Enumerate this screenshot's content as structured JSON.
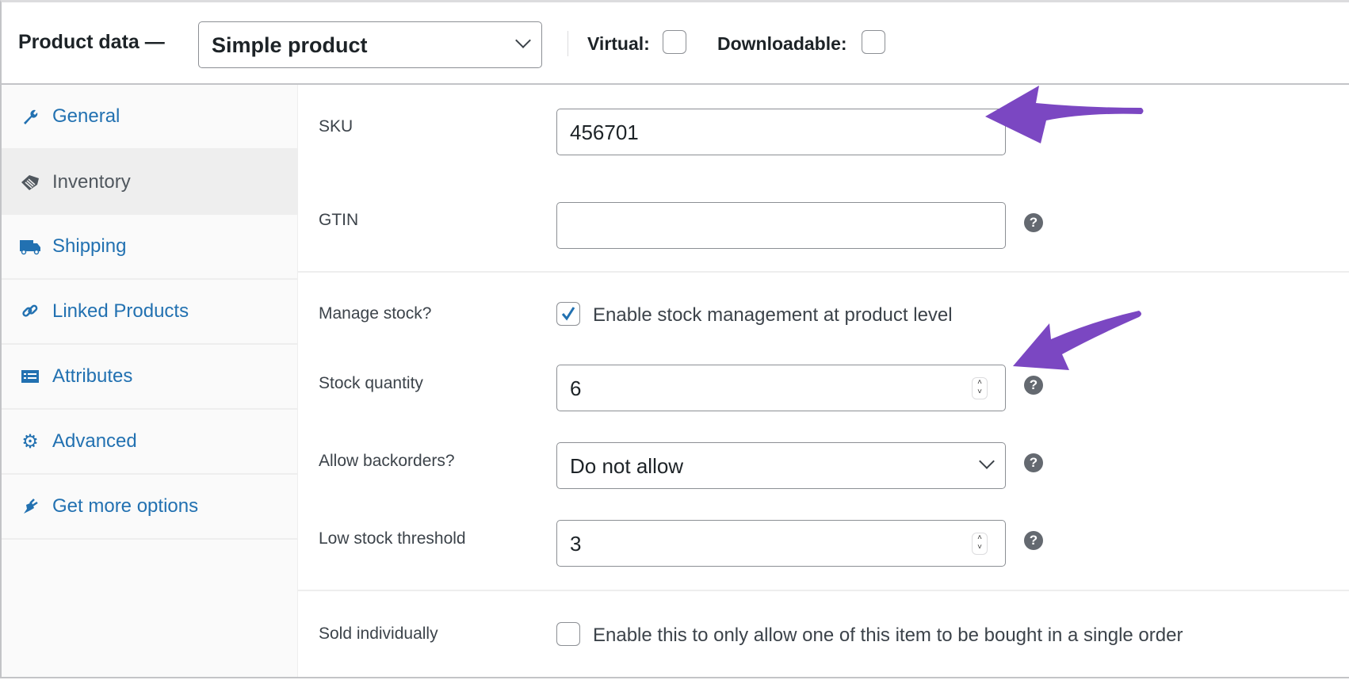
{
  "header": {
    "title": "Product data —",
    "product_type": "Simple product",
    "virtual_label": "Virtual:",
    "virtual_checked": false,
    "downloadable_label": "Downloadable:",
    "downloadable_checked": false
  },
  "sidebar": {
    "items": [
      {
        "label": "General",
        "icon": "wrench-icon"
      },
      {
        "label": "Inventory",
        "icon": "tag-icon",
        "active": true
      },
      {
        "label": "Shipping",
        "icon": "truck-icon"
      },
      {
        "label": "Linked Products",
        "icon": "link-icon"
      },
      {
        "label": "Attributes",
        "icon": "list-icon"
      },
      {
        "label": "Advanced",
        "icon": "gear-icon"
      },
      {
        "label": "Get more options",
        "icon": "plug-icon"
      }
    ]
  },
  "fields": {
    "sku": {
      "label": "SKU",
      "value": "456701"
    },
    "gtin": {
      "label": "GTIN",
      "value": ""
    },
    "manage_stock": {
      "label": "Manage stock?",
      "checkbox_text": "Enable stock management at product level",
      "checked": true
    },
    "stock_quantity": {
      "label": "Stock quantity",
      "value": "6"
    },
    "backorders": {
      "label": "Allow backorders?",
      "value": "Do not allow"
    },
    "low_stock": {
      "label": "Low stock threshold",
      "value": "3"
    },
    "sold_individually": {
      "label": "Sold individually",
      "checkbox_text": "Enable this to only allow one of this item to be bought in a single order",
      "checked": false
    }
  },
  "help_symbol": "?",
  "colors": {
    "link": "#2271b1",
    "annotation_arrow": "#7b47c2",
    "checkbox_check": "#2271b1"
  }
}
